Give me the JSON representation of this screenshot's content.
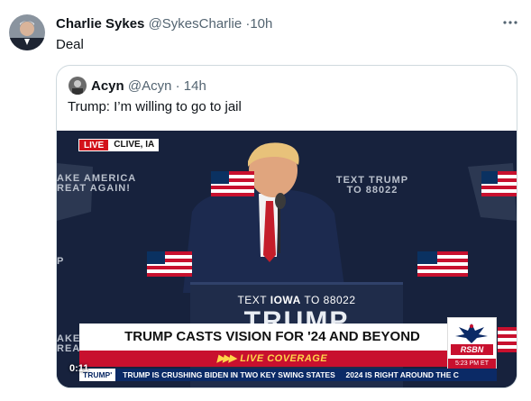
{
  "tweet": {
    "author_name": "Charlie Sykes",
    "handle": "@SykesCharlie",
    "separator": "·",
    "time": "10h",
    "text": "Deal",
    "more_icon": "more-horizontal-icon"
  },
  "quoted_tweet": {
    "author_name": "Acyn",
    "handle": "@Acyn",
    "separator": "·",
    "time": "14h",
    "text": "Trump: I’m willing to go to jail"
  },
  "video": {
    "live_label": "LIVE",
    "location": "CLIVE, IA",
    "banner_left": "AKE AMERICA\nREAT AGAIN!",
    "text_trump": "TEXT TRUMP\nTO 88022",
    "podium_text_prefix": "TEXT ",
    "podium_text_bold": "IOWA",
    "podium_text_suffix": " TO 88022",
    "podium_big": "TRUMP",
    "side_left_1": "P",
    "side_left_2": "AKE\nREA",
    "headline": "TRUMP CASTS VISION FOR '24 AND BEYOND",
    "subline": "LIVE COVERAGE",
    "network": "RSBN",
    "network_time": "5:23 PM ET",
    "ticker_label": "TRUMP'",
    "ticker_text": "TRUMP IS CRUSHING BIDEN IN TWO KEY SWING STATES     2024 IS RIGHT AROUND THE C",
    "timestamp": "0:11"
  },
  "colors": {
    "muted": "#536471",
    "border": "#cfd9de",
    "live_red": "#d3121b",
    "ticker_blue": "#0b2a66"
  }
}
